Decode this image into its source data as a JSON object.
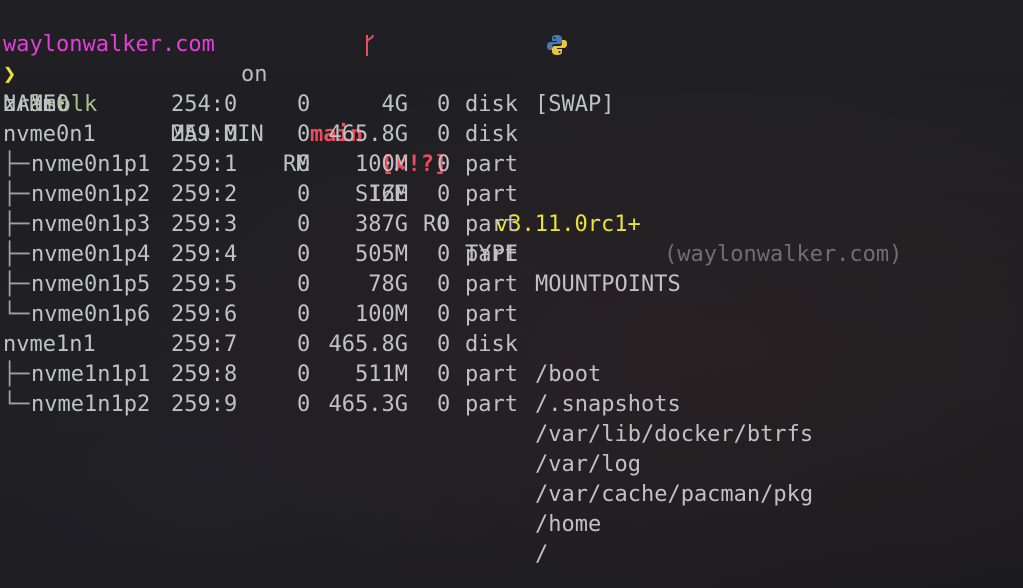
{
  "prompt": {
    "host": "waylonwalker.com",
    "on": "on",
    "branch_icon": "git-branch-icon",
    "branch": "main",
    "status": "[✘!?]",
    "python_icon": "python-icon",
    "python_version": "v3.11.0rc1+",
    "venv": "(waylonwalker.com)",
    "chevron": "❯",
    "command": "lsblk"
  },
  "colors": {
    "host": "#e43ed8",
    "branch": "#ee4c5c",
    "python_version": "#e8e23a",
    "command": "#a9c28a",
    "background": "#1c1c1f",
    "text": "#bfc1c5"
  },
  "table": {
    "headers": {
      "name": "NAME",
      "majmin": "MAJ:MIN",
      "rm": "RM",
      "size": "SIZE",
      "ro": "RO",
      "type": "TYPE",
      "mountpoints": "MOUNTPOINTS"
    },
    "rows": [
      {
        "tree": "",
        "name": "zram0",
        "majmin": "254:0",
        "rm": "0",
        "size": "4G",
        "ro": "0",
        "type": "disk",
        "mount": "[SWAP]"
      },
      {
        "tree": "",
        "name": "nvme0n1",
        "majmin": "259:0",
        "rm": "0",
        "size": "465.8G",
        "ro": "0",
        "type": "disk",
        "mount": ""
      },
      {
        "tree": "├─",
        "name": "nvme0n1p1",
        "majmin": "259:1",
        "rm": "0",
        "size": "100M",
        "ro": "0",
        "type": "part",
        "mount": ""
      },
      {
        "tree": "├─",
        "name": "nvme0n1p2",
        "majmin": "259:2",
        "rm": "0",
        "size": "16M",
        "ro": "0",
        "type": "part",
        "mount": ""
      },
      {
        "tree": "├─",
        "name": "nvme0n1p3",
        "majmin": "259:3",
        "rm": "0",
        "size": "387G",
        "ro": "0",
        "type": "part",
        "mount": ""
      },
      {
        "tree": "├─",
        "name": "nvme0n1p4",
        "majmin": "259:4",
        "rm": "0",
        "size": "505M",
        "ro": "0",
        "type": "part",
        "mount": ""
      },
      {
        "tree": "├─",
        "name": "nvme0n1p5",
        "majmin": "259:5",
        "rm": "0",
        "size": "78G",
        "ro": "0",
        "type": "part",
        "mount": ""
      },
      {
        "tree": "└─",
        "name": "nvme0n1p6",
        "majmin": "259:6",
        "rm": "0",
        "size": "100M",
        "ro": "0",
        "type": "part",
        "mount": ""
      },
      {
        "tree": "",
        "name": "nvme1n1",
        "majmin": "259:7",
        "rm": "0",
        "size": "465.8G",
        "ro": "0",
        "type": "disk",
        "mount": ""
      },
      {
        "tree": "├─",
        "name": "nvme1n1p1",
        "majmin": "259:8",
        "rm": "0",
        "size": "511M",
        "ro": "0",
        "type": "part",
        "mount": "/boot"
      },
      {
        "tree": "└─",
        "name": "nvme1n1p2",
        "majmin": "259:9",
        "rm": "0",
        "size": "465.3G",
        "ro": "0",
        "type": "part",
        "mount": "/.snapshots"
      }
    ],
    "extra_mountpoints": [
      "/var/lib/docker/btrfs",
      "/var/log",
      "/var/cache/pacman/pkg",
      "/home",
      "/"
    ]
  }
}
